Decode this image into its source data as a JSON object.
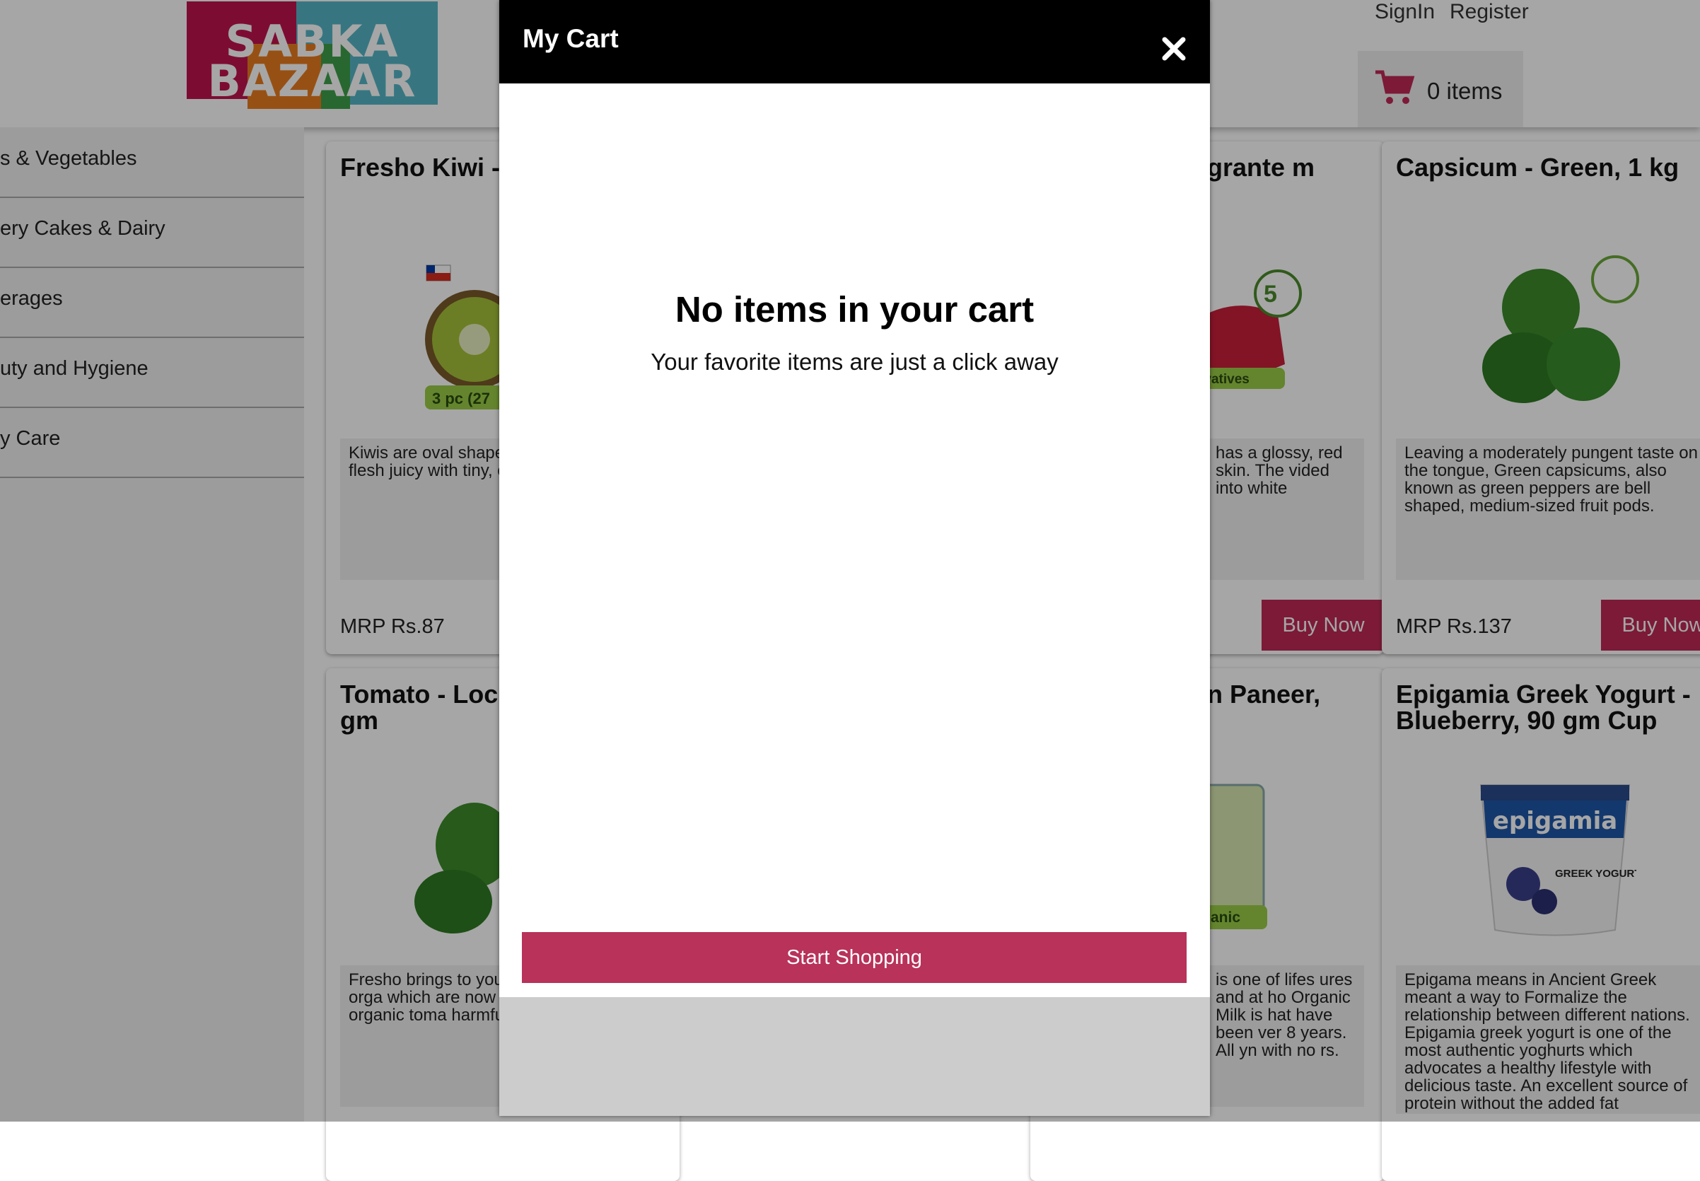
{
  "header": {
    "logo_line1": "SABKA",
    "logo_line2": "BAZAAR",
    "signin": "SignIn",
    "register": "Register",
    "cart_count": "0 items"
  },
  "sidebar": {
    "items": [
      {
        "label": "s & Vegetables"
      },
      {
        "label": "ery Cakes & Dairy"
      },
      {
        "label": "erages"
      },
      {
        "label": "uty and Hygiene"
      },
      {
        "label": "y Care"
      }
    ]
  },
  "products": [
    {
      "title": "Fresho Kiwi - pcs",
      "desc": "Kiwis are oval shape outer skin. The flesh juicy with tiny, edible",
      "price": "MRP Rs.87",
      "buy": "Buy Now",
      "badge": "3 pc (27"
    },
    {
      "title": "grante m",
      "desc": "has a glossy, red skin. The vided into white",
      "price": "",
      "buy": "Buy Now",
      "badge": "rvatives"
    },
    {
      "title": "Capsicum - Green, 1 kg",
      "desc": "Leaving a moderately pungent taste on the tongue, Green capsicums, also known as green peppers are bell shaped, medium-sized fruit pods.",
      "price": "MRP Rs.137",
      "buy": "Buy Now"
    },
    {
      "title": "Tomato - Loc Organically G gm",
      "desc": "Fresho brings to you of locally grown orga which are now availa These organic toma harmful pesticides a",
      "price": "",
      "buy": ""
    },
    {
      "title": "n Paneer,",
      "desc": "is one of lifes ures and at ho Organic Milk is hat have been ver 8 years. All yn with no rs.",
      "price": "",
      "buy": "",
      "badge": "rganic"
    },
    {
      "title": "Epigamia Greek Yogurt - Blueberry, 90 gm Cup",
      "desc": "Epigama means in Ancient Greek meant a way to Formalize the relationship between different nations. Epigamia greek yogurt is one of the most authentic yoghurts which advocates a healthy lifestyle with delicious taste. An excellent source of protein without the added fat",
      "price": "",
      "buy": "",
      "brand": "epigamia",
      "brand2": "GREEK YOGURT"
    }
  ],
  "modal": {
    "title": "My Cart",
    "empty_heading": "No items in your cart",
    "empty_sub": "Your favorite items are just a click away",
    "cta": "Start Shopping"
  },
  "colors": {
    "accent": "#bf2957",
    "modal_header": "#000000"
  }
}
